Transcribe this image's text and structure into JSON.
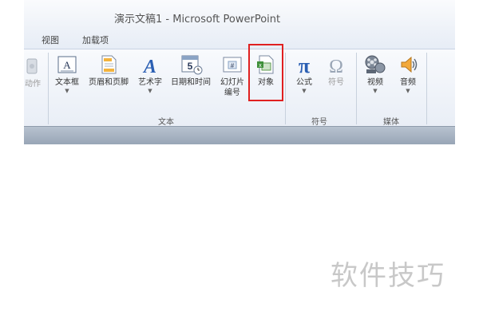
{
  "window": {
    "title": "演示文稿1 - Microsoft PowerPoint"
  },
  "tabs": [
    {
      "label": "视图"
    },
    {
      "label": "加载项"
    }
  ],
  "ribbon": {
    "partial_button": {
      "label": "动作"
    },
    "text_group": {
      "label": "文本",
      "buttons": [
        {
          "label": "文本框",
          "icon": "text-box-icon",
          "has_dropdown": true
        },
        {
          "label": "页眉和页脚",
          "icon": "header-footer-icon",
          "has_dropdown": false
        },
        {
          "label": "艺术字",
          "icon": "wordart-icon",
          "has_dropdown": true
        },
        {
          "label": "日期和时间",
          "icon": "date-time-icon",
          "has_dropdown": false
        },
        {
          "label": "幻灯片",
          "label2": "编号",
          "icon": "slide-number-icon",
          "has_dropdown": false
        },
        {
          "label": "对象",
          "icon": "object-icon",
          "has_dropdown": false,
          "highlighted": true
        }
      ]
    },
    "symbol_group": {
      "label": "符号",
      "buttons": [
        {
          "label": "公式",
          "icon": "equation-icon",
          "has_dropdown": true
        },
        {
          "label": "符号",
          "icon": "symbol-icon",
          "has_dropdown": false,
          "disabled": true
        }
      ]
    },
    "media_group": {
      "label": "媒体",
      "buttons": [
        {
          "label": "视频",
          "icon": "video-icon",
          "has_dropdown": true
        },
        {
          "label": "音频",
          "icon": "audio-icon",
          "has_dropdown": true
        }
      ]
    }
  },
  "watermark": {
    "text": "软件技巧"
  },
  "colors": {
    "highlight_border": "#e02020",
    "accent_blue": "#2b5fb3"
  }
}
